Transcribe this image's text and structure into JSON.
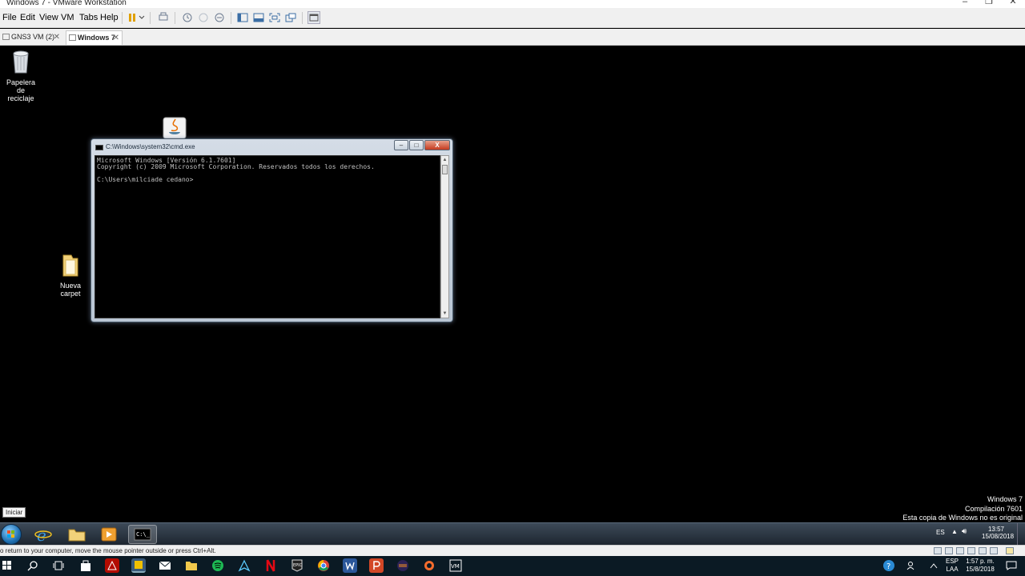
{
  "host_window": {
    "title": "Windows 7 - VMware Workstation",
    "minimize": "–",
    "maximize": "❐",
    "close": "✕"
  },
  "menubar": {
    "items": [
      "File",
      "Edit",
      "View",
      "VM",
      "Tabs",
      "Help"
    ]
  },
  "tabs": [
    {
      "label": "GNS3 VM (2)",
      "close": "✕"
    },
    {
      "label": "Windows 7",
      "close": "✕"
    }
  ],
  "desktop": {
    "icons": [
      {
        "label_line1": "Papelera de",
        "label_line2": "reciclaje"
      },
      {
        "label_line1": "Nueva carpet",
        "label_line2": ""
      }
    ]
  },
  "cmd": {
    "title": "C:\\Windows\\system32\\cmd.exe",
    "minimize": "–",
    "maximize": "□",
    "close": "X",
    "lines": [
      "Microsoft Windows [Versión 6.1.7601]",
      "Copyright (c) 2009 Microsoft Corporation. Reservados todos los derechos.",
      "",
      "C:\\Users\\milciade cedano>"
    ]
  },
  "watermark": {
    "line1": "Windows 7",
    "line2": "Compilación 7601",
    "line3": "Esta copia de Windows no es original"
  },
  "guest_taskbar": {
    "tooltip": "Iniciar",
    "lang": "ES",
    "time": "13:57",
    "date": "15/08/2018"
  },
  "vm_status": {
    "message": "o return to your computer, move the mouse pointer outside or press Ctrl+Alt."
  },
  "host_taskbar": {
    "lang_line1": "ESP",
    "lang_line2": "LAA",
    "time": "1:57 p. m.",
    "date": "15/8/2018"
  },
  "colors": {
    "desktop": "#000000",
    "accent": "#1e6fb0",
    "cmd_text": "#c0c0c0"
  }
}
